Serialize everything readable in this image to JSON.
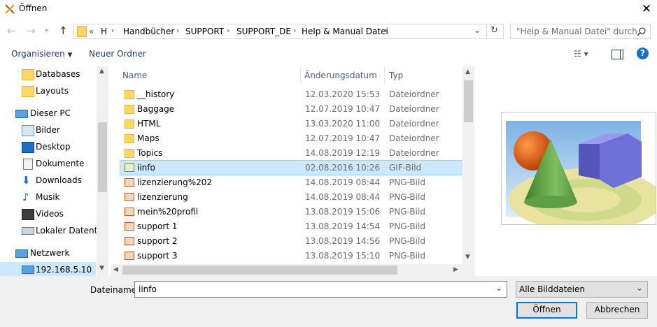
{
  "window": {
    "title": "Öffnen"
  },
  "address": {
    "overflow": "«",
    "crumbs": [
      "H",
      "Handbücher",
      "SUPPORT",
      "SUPPORT_DE",
      "Help & Manual Datei"
    ]
  },
  "search": {
    "placeholder": "\"Help & Manual Datei\" durch..."
  },
  "toolbar": {
    "organize": "Organisieren",
    "new_folder": "Neuer Ordner"
  },
  "nav": {
    "items": [
      {
        "label": "Databases",
        "icon": "folder-icon"
      },
      {
        "label": "Layouts",
        "icon": "folder-icon"
      },
      {
        "label": "Dieser PC",
        "icon": "computer-icon"
      },
      {
        "label": "Bilder",
        "icon": "pictures-icon"
      },
      {
        "label": "Desktop",
        "icon": "desktop-icon"
      },
      {
        "label": "Dokumente",
        "icon": "documents-icon"
      },
      {
        "label": "Downloads",
        "icon": "downloads-icon"
      },
      {
        "label": "Musik",
        "icon": "music-icon"
      },
      {
        "label": "Videos",
        "icon": "videos-icon"
      },
      {
        "label": "Lokaler Datenträ",
        "icon": "drive-icon"
      },
      {
        "label": "Netzwerk",
        "icon": "network-icon"
      },
      {
        "label": "192.168.5.10",
        "icon": "network-computer-icon"
      }
    ]
  },
  "columns": {
    "name": "Name",
    "date": "Änderungsdatum",
    "type": "Typ"
  },
  "files": [
    {
      "name": "__history",
      "date": "12.03.2020 15:53",
      "type": "Dateiordner",
      "kind": "folder"
    },
    {
      "name": "Baggage",
      "date": "12.07.2019 10:47",
      "type": "Dateiordner",
      "kind": "folder"
    },
    {
      "name": "HTML",
      "date": "13.03.2020 11:00",
      "type": "Dateiordner",
      "kind": "folder"
    },
    {
      "name": "Maps",
      "date": "12.07.2019 10:47",
      "type": "Dateiordner",
      "kind": "folder"
    },
    {
      "name": "Topics",
      "date": "14.08.2019 12:19",
      "type": "Dateiordner",
      "kind": "folder"
    },
    {
      "name": "iinfo",
      "date": "02.08.2016 10:26",
      "type": "GIF-Bild",
      "kind": "gif",
      "selected": true
    },
    {
      "name": "lizenzierung%202",
      "date": "14.08.2019 08:44",
      "type": "PNG-Bild",
      "kind": "png"
    },
    {
      "name": "lizenzierung",
      "date": "14.08.2019 08:44",
      "type": "PNG-Bild",
      "kind": "png"
    },
    {
      "name": "mein%20profil",
      "date": "13.08.2019 15:06",
      "type": "PNG-Bild",
      "kind": "png"
    },
    {
      "name": "support 1",
      "date": "13.08.2019 14:54",
      "type": "PNG-Bild",
      "kind": "png"
    },
    {
      "name": "support 2",
      "date": "13.08.2019 14:56",
      "type": "PNG-Bild",
      "kind": "png"
    },
    {
      "name": "support 3",
      "date": "13.08.2019 15:10",
      "type": "PNG-Bild",
      "kind": "png"
    }
  ],
  "bottom": {
    "filename_label": "Dateiname:",
    "filename_value": "iinfo",
    "filetype": "Alle Bilddateien",
    "open": "Öffnen",
    "cancel": "Abbrechen"
  },
  "colors": {
    "selection": "#cce8ff",
    "accent": "#0078d7",
    "folder": "#ffd766"
  }
}
